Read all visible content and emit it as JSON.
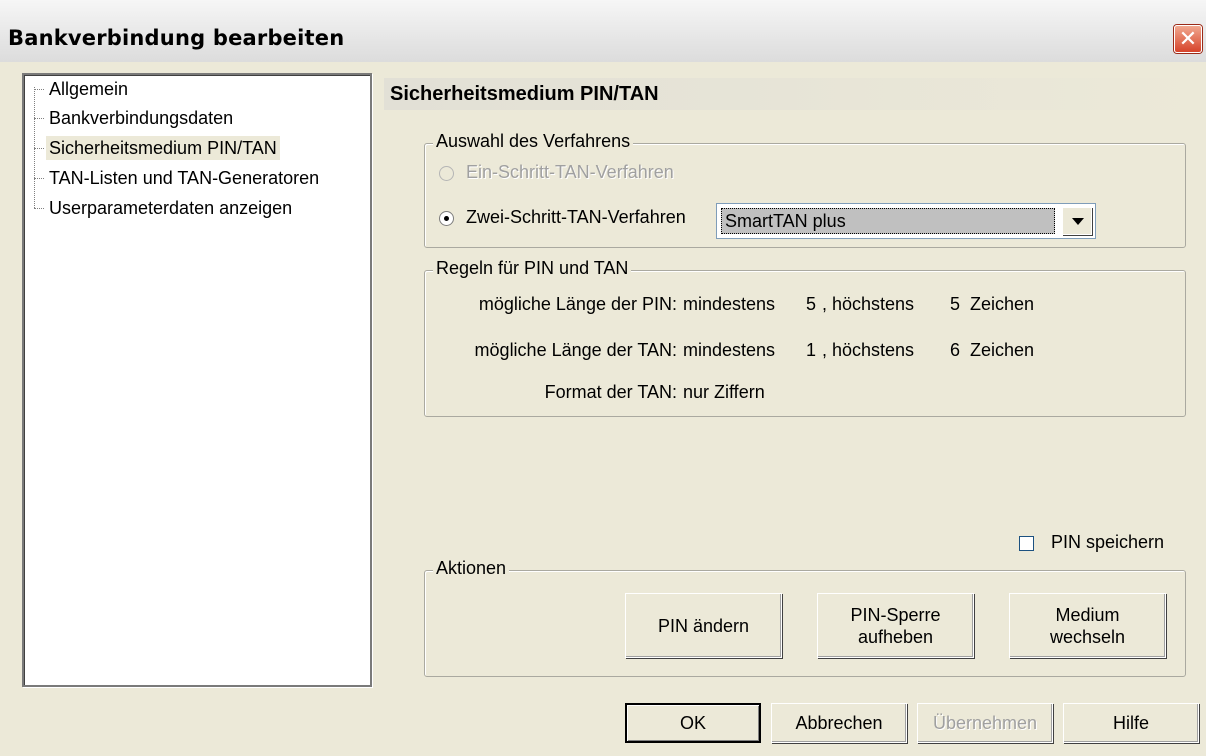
{
  "window": {
    "title": "Bankverbindung bearbeiten"
  },
  "tree": {
    "items": [
      {
        "label": "Allgemein"
      },
      {
        "label": "Bankverbindungsdaten"
      },
      {
        "label": "Sicherheitsmedium PIN/TAN"
      },
      {
        "label": "TAN-Listen und TAN-Generatoren"
      },
      {
        "label": "Userparameterdaten anzeigen"
      }
    ],
    "selected": "Sicherheitsmedium PIN/TAN"
  },
  "panel": {
    "title": "Sicherheitsmedium PIN/TAN"
  },
  "verfahren": {
    "legend": "Auswahl des Verfahrens",
    "one_step": "Ein-Schritt-TAN-Verfahren",
    "two_step": "Zwei-Schritt-TAN-Verfahren",
    "selected_option": "SmartTAN plus"
  },
  "regeln": {
    "legend": "Regeln für PIN und TAN",
    "pin_label": "mögliche Länge der PIN:",
    "pin_min_label": "mindestens",
    "pin_min": "5",
    "pin_max_label": ", höchstens",
    "pin_max": "5",
    "pin_unit": "Zeichen",
    "tan_label": "mögliche Länge der TAN:",
    "tan_min_label": "mindestens",
    "tan_min": "1",
    "tan_max_label": ", höchstens",
    "tan_max": "6",
    "tan_unit": "Zeichen",
    "format_label": "Format der TAN:",
    "format_value": "nur Ziffern"
  },
  "pin_save": {
    "label": "PIN speichern",
    "checked": false
  },
  "aktionen": {
    "legend": "Aktionen",
    "change_pin": "PIN ändern",
    "unlock_pin": "PIN-Sperre\naufheben",
    "change_medium": "Medium\nwechseln"
  },
  "footer": {
    "ok": "OK",
    "cancel": "Abbrechen",
    "apply": "Übernehmen",
    "help": "Hilfe"
  }
}
